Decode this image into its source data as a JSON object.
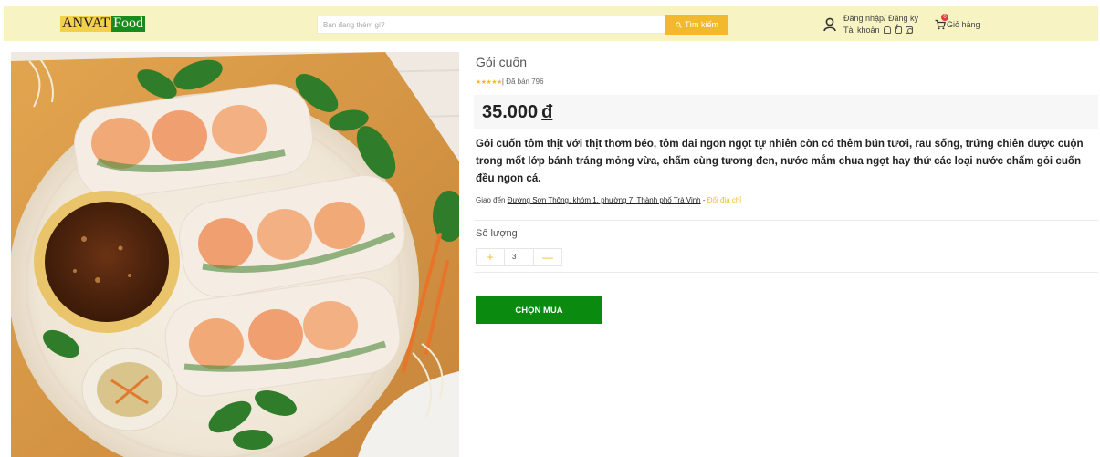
{
  "header": {
    "logo_part1": "ANVAT",
    "logo_part2": "Food",
    "search_placeholder": "Bạn đang thèm gì?",
    "search_button": "Tìm kiếm",
    "account_line1": "Đăng nhập/ Đăng ký",
    "account_line2": "Tài khoản",
    "cart_label": "Giỏ hàng",
    "cart_count": "0"
  },
  "product": {
    "name": "Gỏi cuốn",
    "rating_stars": "★★★★★",
    "sold_text": "| Đã bán 796",
    "price": "35.000",
    "currency": "đ",
    "description": "Gỏi cuốn tôm thịt với thịt thơm béo, tôm dai ngon ngọt tự nhiên còn có thêm bún tươi, rau sống, trứng chiên được cuộn trong mốt lớp bánh tráng mỏng vừa, chấm cùng tương đen, nước mắm chua ngọt hay thứ các loại nước chấm gỏi cuốn đều ngon cá.",
    "delivery_prefix": "Giao đến ",
    "delivery_address": "Đường Sơn Thông, khóm 1, phường 7, Thành phố Trà Vinh",
    "delivery_sep": " - ",
    "delivery_change": "Đổi địa chỉ",
    "quantity_label": "Số lượng",
    "quantity_value": "3",
    "plus": "+",
    "minus": "—",
    "buy_button": "CHỌN MUA"
  },
  "colors": {
    "header_bg": "#f7f3c3",
    "accent_yellow": "#f2b92f",
    "buy_green": "#0a8a0e",
    "logo_green": "#1a8a1c",
    "badge_red": "#e13b3b"
  }
}
